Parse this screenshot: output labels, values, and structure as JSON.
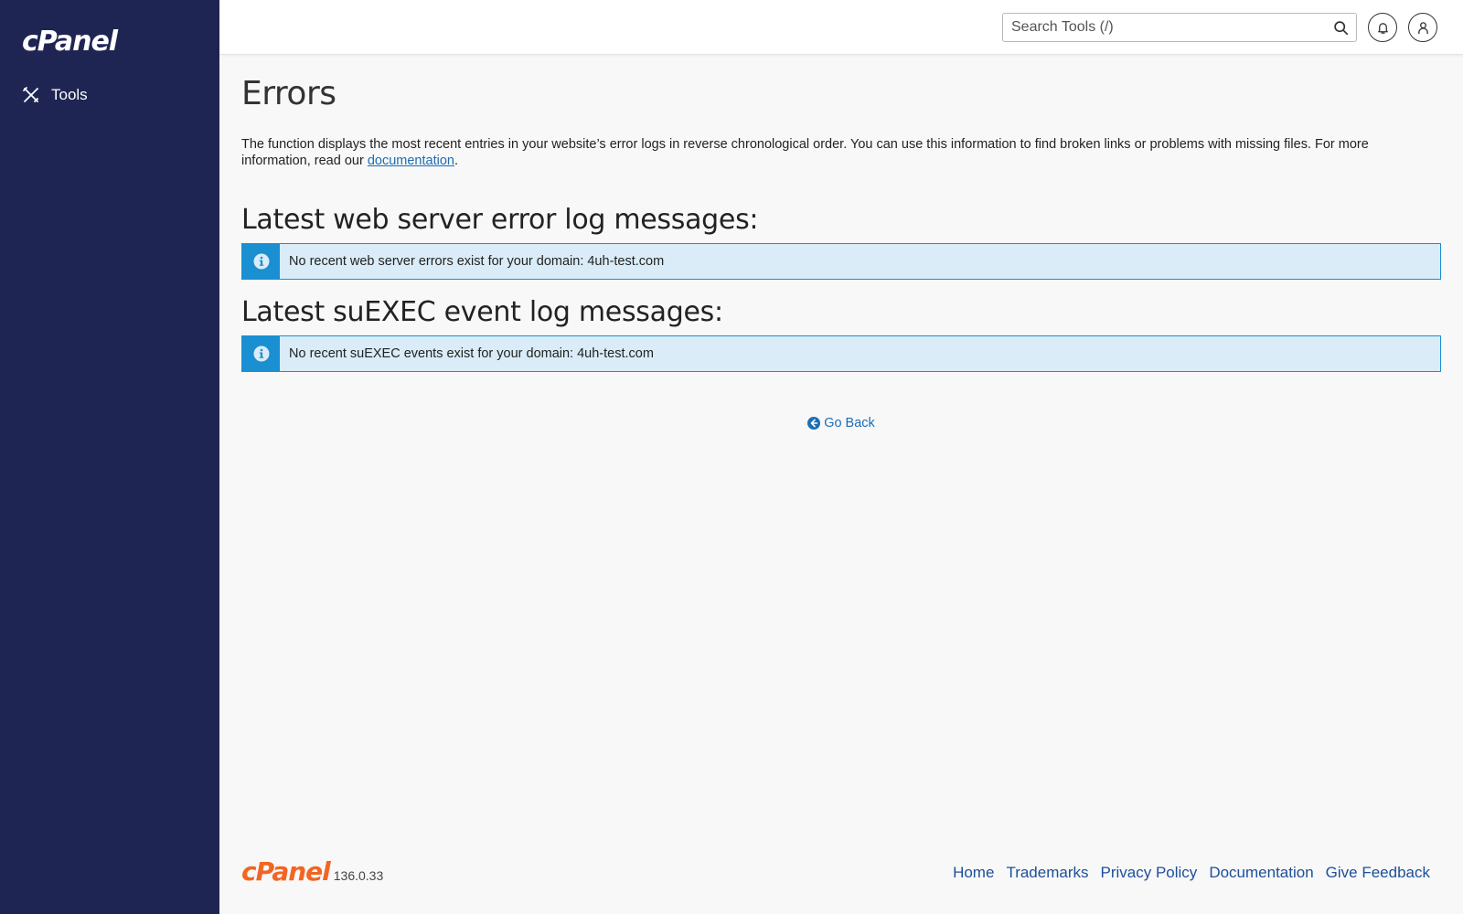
{
  "sidebar": {
    "logo": "cPanel",
    "items": [
      {
        "label": "Tools",
        "icon": "tools-icon"
      }
    ]
  },
  "header": {
    "search_placeholder": "Search Tools (/)",
    "search_value": "",
    "icons": [
      "search-icon",
      "bell-icon",
      "user-icon"
    ]
  },
  "main": {
    "title": "Errors",
    "description_text": "The function displays the most recent entries in your website’s error logs in reverse chronological order. You can use this information to find broken links or problems with missing files. For more information, read our ",
    "description_link": "documentation",
    "description_end": ".",
    "sections": [
      {
        "title": "Latest web server error log messages:",
        "message": "No recent web server errors exist for your domain: 4uh-test.com"
      },
      {
        "title": "Latest suEXEC event log messages:",
        "message": "No recent suEXEC events exist for your domain: 4uh-test.com"
      }
    ],
    "go_back_label": "Go Back"
  },
  "footer": {
    "brand": "cPanel",
    "version": "136.0.33",
    "links": [
      "Home",
      "Trademarks",
      "Privacy Policy",
      "Documentation",
      "Give Feedback"
    ]
  },
  "colors": {
    "sidebar_bg": "#1f2553",
    "callout_border": "#1a8fd2",
    "callout_bg": "#d9ecf8",
    "link": "#1d6db5",
    "footer_brand": "#f26522"
  }
}
